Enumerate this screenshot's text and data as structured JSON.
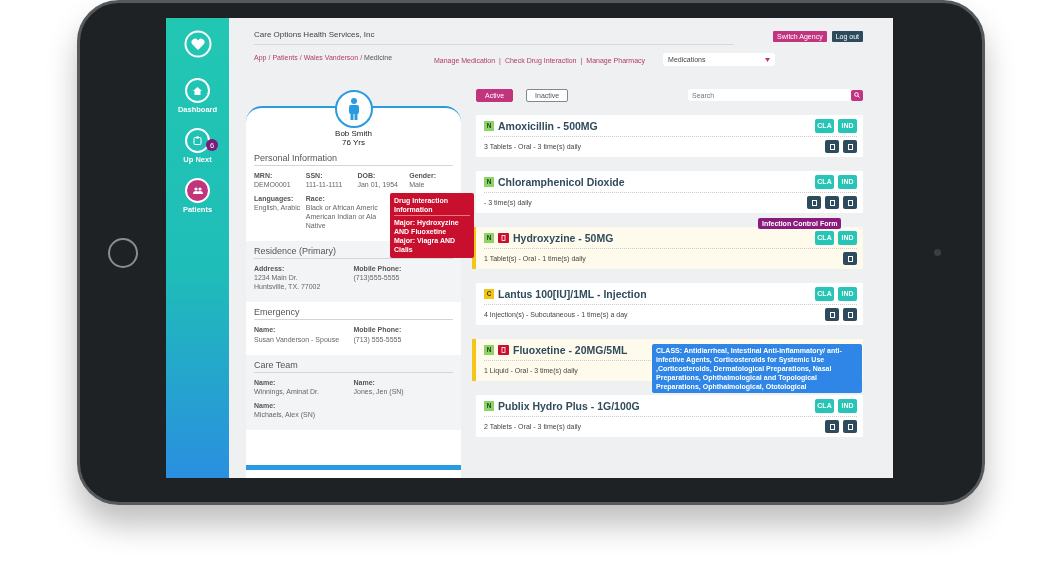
{
  "header": {
    "title": "Care Options Health Services, Inc",
    "buttons": [
      {
        "label": "Switch Agency",
        "kind": "primary"
      },
      {
        "label": "Log out",
        "kind": "secondary"
      }
    ]
  },
  "sidebar": {
    "items": [
      {
        "label": "Dashboard",
        "selected": false
      },
      {
        "label": "Up Next",
        "selected": false,
        "badge": "6"
      },
      {
        "label": "Patients",
        "selected": true
      }
    ]
  },
  "breadcrumb": {
    "separator": "/",
    "items": [
      "App",
      "Patients",
      "Wales Vanderson",
      "Medicine"
    ]
  },
  "nav_links": {
    "separator": "|",
    "items": [
      "Manage Medication",
      "Check Drug Interaction",
      "Manage Pharmacy"
    ]
  },
  "view_select": {
    "value": "Medications"
  },
  "patient": {
    "name": "Bob Smith",
    "age": "76 Yrs",
    "sections": [
      {
        "title": "Personal Information",
        "shaded": false,
        "rows": [
          [
            {
              "label": "MRN:",
              "lines": [
                "DEMO0001"
              ]
            },
            {
              "label": "SSN:",
              "lines": [
                "111-11-1111"
              ]
            },
            {
              "label": "DOB:",
              "lines": [
                "Jan 01, 1954"
              ]
            },
            {
              "label": "Gender:",
              "lines": [
                "Male"
              ]
            }
          ],
          [
            {
              "label": "Languages:",
              "lines": [
                "English, Arabic"
              ]
            },
            {
              "label": "Race:",
              "lines": [
                "Black or African Americ",
                "American Indian or Ala",
                "Native"
              ]
            }
          ]
        ]
      },
      {
        "title": "Residence (Primary)",
        "shaded": true,
        "rows": [
          [
            {
              "label": "Address:",
              "lines": [
                "1234 Main Dr.",
                "Huntsville, TX. 77002"
              ]
            },
            {
              "label": "Mobile Phone:",
              "lines": [
                "(713)555-5555"
              ]
            }
          ]
        ]
      },
      {
        "title": "Emergency",
        "shaded": false,
        "rows": [
          [
            {
              "label": "Name:",
              "lines": [
                "Susan Vanderson - Spouse"
              ]
            },
            {
              "label": "Mobile Phone:",
              "lines": [
                "(713) 555-5555"
              ]
            }
          ]
        ]
      },
      {
        "title": "Care Team",
        "shaded": true,
        "rows": [
          [
            {
              "label": "Name:",
              "lines": [
                "Winnings, Aminat Dr."
              ]
            },
            {
              "label": "Name:",
              "lines": [
                "Jones, Jen (SN)"
              ]
            }
          ],
          [
            {
              "label": "Name:",
              "lines": [
                "Michaels, Alex (SN)"
              ]
            }
          ]
        ]
      }
    ]
  },
  "filter": {
    "tabs": [
      {
        "label": "Active",
        "selected": true
      },
      {
        "label": "Inactive",
        "selected": false
      }
    ],
    "search": {
      "placeholder": "Search"
    }
  },
  "medications": [
    {
      "code": "N",
      "color": "#8ed36a",
      "alert": false,
      "highlighted": false,
      "name": "Amoxicillin - 500MG",
      "detail": "3 Tablets - Oral - 3 time(s) daily",
      "tags": [
        "CLA",
        "IND"
      ],
      "actions": [
        {
          "kind": "doc"
        },
        {
          "kind": "doc"
        }
      ]
    },
    {
      "code": "N",
      "color": "#8ed36a",
      "alert": false,
      "highlighted": false,
      "name": "Chloramphenicol Dioxide",
      "detail": "- 3 time(s) daily",
      "tags": [
        "CLA",
        "IND"
      ],
      "actions": [
        {
          "kind": "doc"
        },
        {
          "kind": "doc"
        },
        {
          "kind": "doc"
        }
      ]
    },
    {
      "code": "N",
      "color": "#8ed36a",
      "alert": true,
      "highlighted": true,
      "name": "Hydroxyzine - 50MG",
      "detail": "1 Tablet(s) - Oral - 1 time(s) daily",
      "tags": [
        "CLA",
        "IND"
      ],
      "actions": [
        {
          "kind": "doc"
        }
      ]
    },
    {
      "code": "C",
      "color": "#f3c413",
      "alert": false,
      "highlighted": false,
      "name": "Lantus 100[IU]/1ML - Injection",
      "detail": "4 Injection(s) - Subcutaneous - 1 time(s) a day",
      "tags": [
        "CLA",
        "IND"
      ],
      "actions": [
        {
          "kind": "doc"
        },
        {
          "kind": "doc"
        }
      ]
    },
    {
      "code": "N",
      "color": "#8ed36a",
      "alert": true,
      "highlighted": true,
      "name": "Fluoxetine - 20MG/5ML",
      "detail": "1 Liquid - Oral - 3 time(s) daily"
    },
    {
      "code": "N",
      "color": "#8ed36a",
      "alert": false,
      "highlighted": false,
      "name": "Publix Hydro Plus - 1G/100G",
      "detail": "2 Tablets - Oral - 3 time(s) daily",
      "tags": [
        "CLA",
        "IND"
      ],
      "actions": [
        {
          "kind": "doc"
        },
        {
          "kind": "doc"
        }
      ]
    }
  ],
  "drug_interaction_popup": {
    "title": "Drug Interaction Information",
    "lines": [
      "Major: Hydroxyzine AND Fluoxetine",
      "Major: Viagra AND Cialis"
    ]
  },
  "infection_popup": {
    "text": "Infection Control Form"
  },
  "class_popup": {
    "text": "**CLASS:** Antidiarrheal, Intestinal Anti-inflammatory/ anti-infective Agents, Corticosteroids for Systemic Use ,Corticosteroids, Dermatological Preparations, Nasal Preparations, Ophthalmological and Topological Preparations, Ophthalmological, Ototological"
  }
}
